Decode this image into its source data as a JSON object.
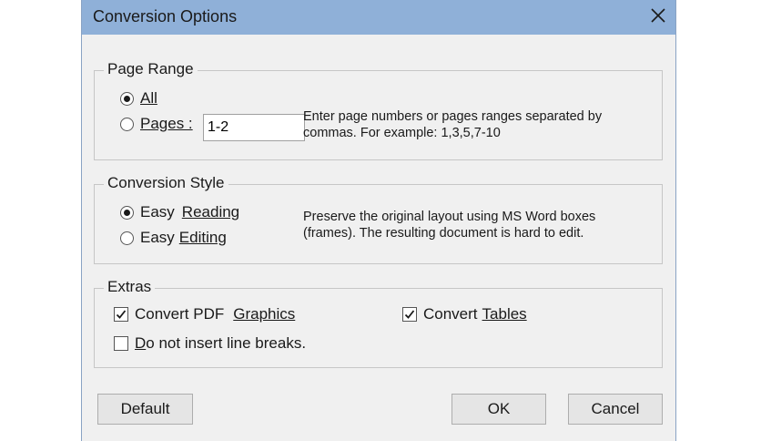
{
  "dialog": {
    "title": "Conversion Options",
    "close_icon": "close-icon"
  },
  "page_range": {
    "legend": "Page Range",
    "all_label": "All",
    "all_selected": true,
    "pages_label": "Pages :",
    "pages_value": "1-2",
    "hint": "Enter page numbers or pages ranges separated by commas. For example: 1,3,5,7-10"
  },
  "conversion_style": {
    "legend": "Conversion Style",
    "reading_prefix": "Easy",
    "reading_label": "Reading",
    "editing_prefix": "Easy",
    "editing_label": "Editing",
    "selected": "reading",
    "hint": "Preserve the original layout using MS Word boxes (frames). The resulting document is hard to edit."
  },
  "extras": {
    "legend": "Extras",
    "graphics_prefix": "Convert PDF",
    "graphics_label": "Graphics",
    "graphics_checked": true,
    "tables_prefix": "Convert",
    "tables_label": "Tables",
    "tables_checked": true,
    "linebreaks_label_underlined": "D",
    "linebreaks_label_rest": "o not insert line breaks.",
    "linebreaks_checked": false
  },
  "buttons": {
    "default": "Default",
    "ok": "OK",
    "cancel": "Cancel"
  }
}
